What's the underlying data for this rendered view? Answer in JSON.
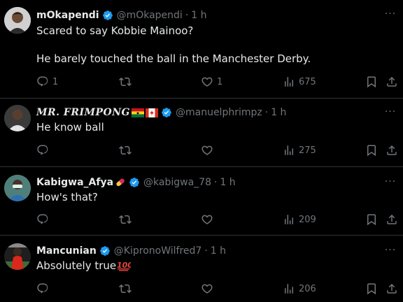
{
  "tweets": [
    {
      "name": "mOkapendi",
      "handle": "@mOkapendi",
      "dot": "·",
      "time": "1 h",
      "text": "Scared to say Kobbie Mainoo?\n\nHe barely touched the ball in the Manchester Derby.",
      "replies": "1",
      "retweets": "",
      "likes": "1",
      "views": "675",
      "avatar_color": "#c9c9c9"
    },
    {
      "name": "MR. FRIMPONG",
      "handle": "@manuelphrimpz",
      "dot": "·",
      "time": "1 h",
      "text": "He know ball",
      "replies": "",
      "retweets": "",
      "likes": "",
      "views": "275",
      "avatar_color": "#3a3a3a"
    },
    {
      "name": "Kabigwa_Afya",
      "handle": "@kabigwa_78",
      "dot": "·",
      "time": "1 h",
      "text": "How's that?",
      "replies": "",
      "retweets": "",
      "likes": "",
      "views": "209",
      "avatar_color": "#4e7d7a"
    },
    {
      "name": "Mancunian",
      "handle": "@KipronoWilfred7",
      "dot": "·",
      "time": "1 h",
      "text": "Absolutely true",
      "replies": "",
      "retweets": "",
      "likes": "",
      "views": "206",
      "avatar_color": "#2a2a2a"
    }
  ],
  "more_label": "···",
  "colors": {
    "background": "#000000",
    "text": "#e7e9ea",
    "muted": "#71767b",
    "verified": "#1d9bf0",
    "divider": "#2f3336"
  }
}
